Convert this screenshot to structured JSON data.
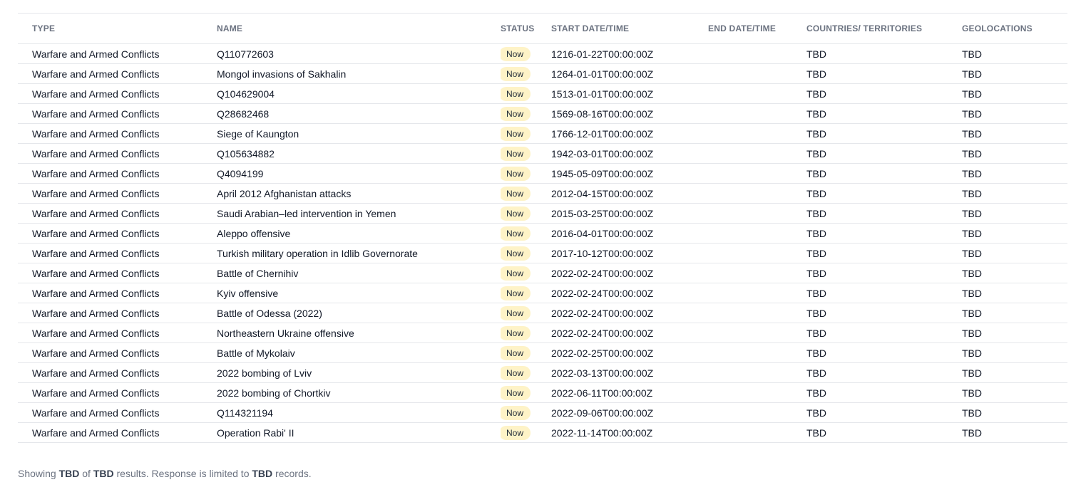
{
  "table": {
    "headers": {
      "type": "TYPE",
      "name": "NAME",
      "status": "STATUS",
      "start": "START DATE/TIME",
      "end": "END DATE/TIME",
      "countries": "COUNTRIES/ TERRITORIES",
      "geolocations": "GEOLOCATIONS"
    },
    "rows": [
      {
        "type": "Warfare and Armed Conflicts",
        "name": "Q110772603",
        "status": "Now",
        "start": "1216-01-22T00:00:00Z",
        "end": "",
        "countries": "TBD",
        "geolocations": "TBD"
      },
      {
        "type": "Warfare and Armed Conflicts",
        "name": "Mongol invasions of Sakhalin",
        "status": "Now",
        "start": "1264-01-01T00:00:00Z",
        "end": "",
        "countries": "TBD",
        "geolocations": "TBD"
      },
      {
        "type": "Warfare and Armed Conflicts",
        "name": "Q104629004",
        "status": "Now",
        "start": "1513-01-01T00:00:00Z",
        "end": "",
        "countries": "TBD",
        "geolocations": "TBD"
      },
      {
        "type": "Warfare and Armed Conflicts",
        "name": "Q28682468",
        "status": "Now",
        "start": "1569-08-16T00:00:00Z",
        "end": "",
        "countries": "TBD",
        "geolocations": "TBD"
      },
      {
        "type": "Warfare and Armed Conflicts",
        "name": "Siege of Kaungton",
        "status": "Now",
        "start": "1766-12-01T00:00:00Z",
        "end": "",
        "countries": "TBD",
        "geolocations": "TBD"
      },
      {
        "type": "Warfare and Armed Conflicts",
        "name": "Q105634882",
        "status": "Now",
        "start": "1942-03-01T00:00:00Z",
        "end": "",
        "countries": "TBD",
        "geolocations": "TBD"
      },
      {
        "type": "Warfare and Armed Conflicts",
        "name": "Q4094199",
        "status": "Now",
        "start": "1945-05-09T00:00:00Z",
        "end": "",
        "countries": "TBD",
        "geolocations": "TBD"
      },
      {
        "type": "Warfare and Armed Conflicts",
        "name": "April 2012 Afghanistan attacks",
        "status": "Now",
        "start": "2012-04-15T00:00:00Z",
        "end": "",
        "countries": "TBD",
        "geolocations": "TBD"
      },
      {
        "type": "Warfare and Armed Conflicts",
        "name": "Saudi Arabian–led intervention in Yemen",
        "status": "Now",
        "start": "2015-03-25T00:00:00Z",
        "end": "",
        "countries": "TBD",
        "geolocations": "TBD"
      },
      {
        "type": "Warfare and Armed Conflicts",
        "name": "Aleppo offensive",
        "status": "Now",
        "start": "2016-04-01T00:00:00Z",
        "end": "",
        "countries": "TBD",
        "geolocations": "TBD"
      },
      {
        "type": "Warfare and Armed Conflicts",
        "name": "Turkish military operation in Idlib Governorate",
        "status": "Now",
        "start": "2017-10-12T00:00:00Z",
        "end": "",
        "countries": "TBD",
        "geolocations": "TBD"
      },
      {
        "type": "Warfare and Armed Conflicts",
        "name": "Battle of Chernihiv",
        "status": "Now",
        "start": "2022-02-24T00:00:00Z",
        "end": "",
        "countries": "TBD",
        "geolocations": "TBD"
      },
      {
        "type": "Warfare and Armed Conflicts",
        "name": "Kyiv offensive",
        "status": "Now",
        "start": "2022-02-24T00:00:00Z",
        "end": "",
        "countries": "TBD",
        "geolocations": "TBD"
      },
      {
        "type": "Warfare and Armed Conflicts",
        "name": "Battle of Odessa (2022)",
        "status": "Now",
        "start": "2022-02-24T00:00:00Z",
        "end": "",
        "countries": "TBD",
        "geolocations": "TBD"
      },
      {
        "type": "Warfare and Armed Conflicts",
        "name": "Northeastern Ukraine offensive",
        "status": "Now",
        "start": "2022-02-24T00:00:00Z",
        "end": "",
        "countries": "TBD",
        "geolocations": "TBD"
      },
      {
        "type": "Warfare and Armed Conflicts",
        "name": "Battle of Mykolaiv",
        "status": "Now",
        "start": "2022-02-25T00:00:00Z",
        "end": "",
        "countries": "TBD",
        "geolocations": "TBD"
      },
      {
        "type": "Warfare and Armed Conflicts",
        "name": "2022 bombing of Lviv",
        "status": "Now",
        "start": "2022-03-13T00:00:00Z",
        "end": "",
        "countries": "TBD",
        "geolocations": "TBD"
      },
      {
        "type": "Warfare and Armed Conflicts",
        "name": "2022 bombing of Chortkiv",
        "status": "Now",
        "start": "2022-06-11T00:00:00Z",
        "end": "",
        "countries": "TBD",
        "geolocations": "TBD"
      },
      {
        "type": "Warfare and Armed Conflicts",
        "name": "Q114321194",
        "status": "Now",
        "start": "2022-09-06T00:00:00Z",
        "end": "",
        "countries": "TBD",
        "geolocations": "TBD"
      },
      {
        "type": "Warfare and Armed Conflicts",
        "name": "Operation Rabi' II",
        "status": "Now",
        "start": "2022-11-14T00:00:00Z",
        "end": "",
        "countries": "TBD",
        "geolocations": "TBD"
      }
    ]
  },
  "footer": {
    "showing": "Showing",
    "shown_count": "TBD",
    "of": "of",
    "total_count": "TBD",
    "results_text": "results. Response is limited to",
    "limit_count": "TBD",
    "records": "records."
  },
  "colors": {
    "badge_bg": "#fef3c7",
    "border": "#e5e7eb",
    "header_text": "#6b7280"
  }
}
